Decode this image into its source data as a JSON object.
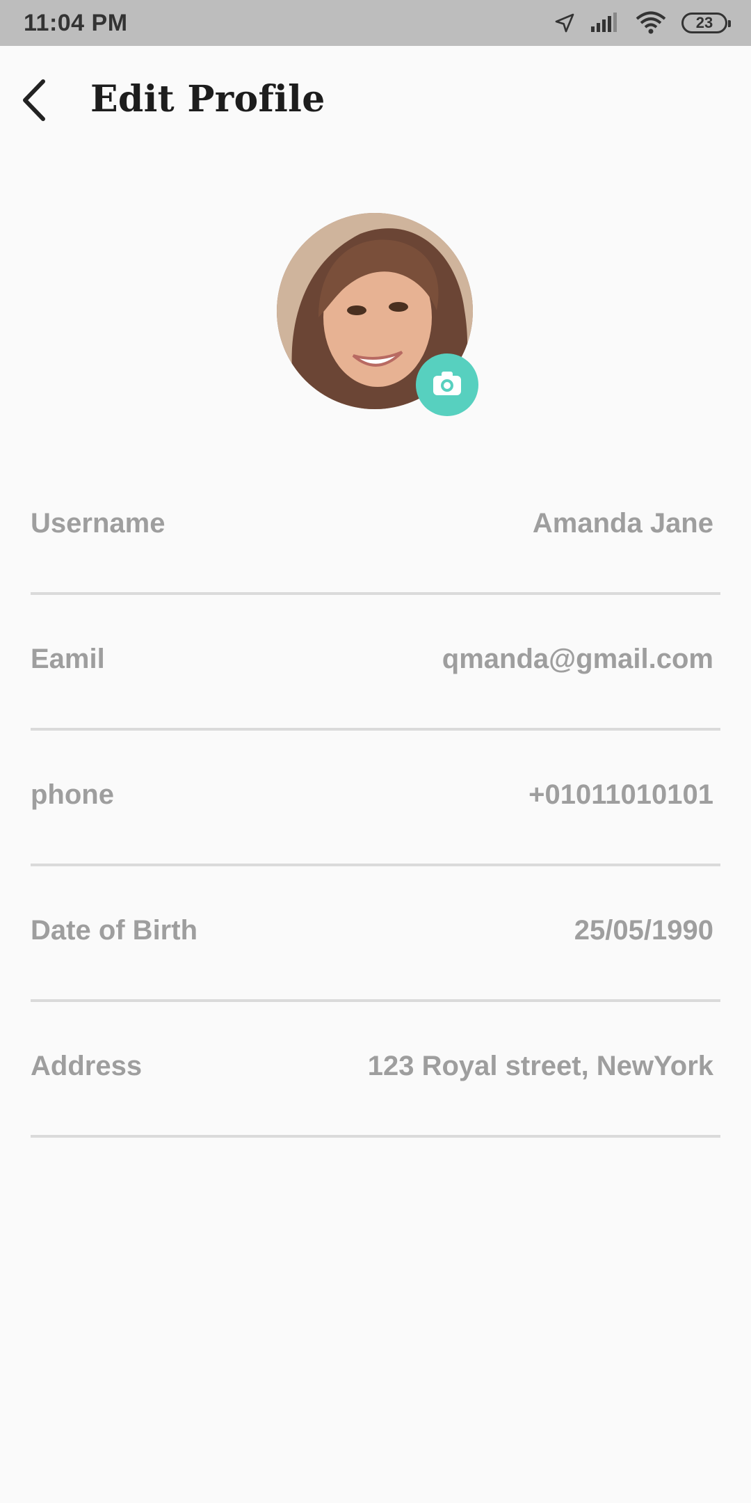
{
  "status_bar": {
    "time": "11:04 PM",
    "battery": "23"
  },
  "header": {
    "title": "Edit Profile",
    "back_icon": "chevron-left-icon"
  },
  "avatar": {
    "camera_icon": "camera-icon",
    "camera_color": "#57d0bf"
  },
  "fields": [
    {
      "label": "Username",
      "value": "Amanda Jane"
    },
    {
      "label": "Eamil",
      "value": "qmanda@gmail.com"
    },
    {
      "label": "phone",
      "value": "+01011010101"
    },
    {
      "label": "Date of Birth",
      "value": "25/05/1990"
    },
    {
      "label": "Address",
      "value": "123 Royal street, NewYork"
    }
  ]
}
